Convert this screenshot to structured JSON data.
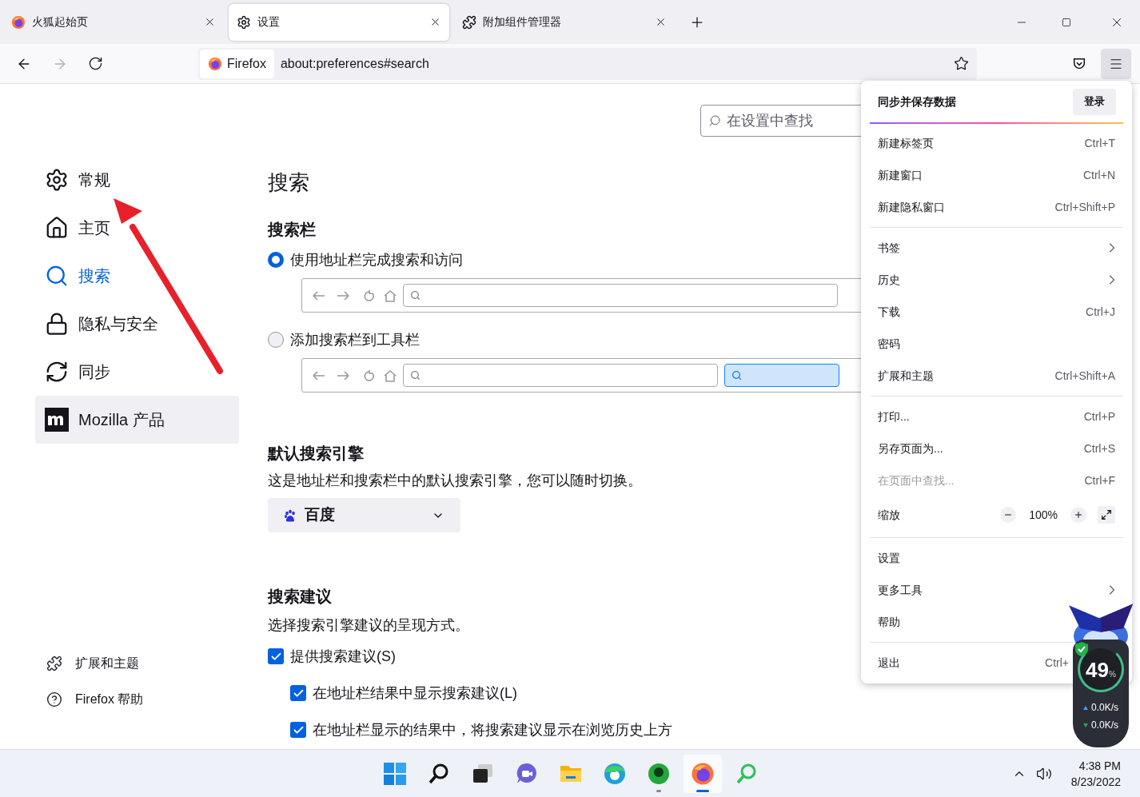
{
  "tabs": [
    {
      "label": "火狐起始页",
      "selected": false
    },
    {
      "label": "设置",
      "selected": true
    },
    {
      "label": "附加组件管理器",
      "selected": false
    }
  ],
  "address_bar": {
    "identity": "Firefox",
    "url": "about:preferences#search"
  },
  "search_field": {
    "placeholder": "在设置中查找"
  },
  "sidebar": {
    "items": [
      {
        "label": "常规",
        "selected": false,
        "hovered": false
      },
      {
        "label": "主页",
        "selected": false,
        "hovered": false
      },
      {
        "label": "搜索",
        "selected": true,
        "hovered": false
      },
      {
        "label": "隐私与安全",
        "selected": false,
        "hovered": false
      },
      {
        "label": "同步",
        "selected": false,
        "hovered": false
      },
      {
        "label": "Mozilla 产品",
        "selected": false,
        "hovered": true
      }
    ],
    "footer": [
      {
        "label": "扩展和主题"
      },
      {
        "label": "Firefox 帮助"
      }
    ]
  },
  "page_title": "搜索",
  "search_bar_section": {
    "heading": "搜索栏",
    "options": [
      {
        "label": "使用地址栏完成搜索和访问",
        "selected": true
      },
      {
        "label": "添加搜索栏到工具栏",
        "selected": false
      }
    ]
  },
  "default_engine": {
    "heading": "默认搜索引擎",
    "description": "这是地址栏和搜索栏中的默认搜索引擎，您可以随时切换。",
    "engine": "百度"
  },
  "suggestions": {
    "heading": "搜索建议",
    "description": "选择搜索引擎建议的呈现方式。",
    "options": [
      {
        "label": "提供搜索建议(S)",
        "checked": true,
        "children": [
          {
            "label": "在地址栏结果中显示搜索建议(L)",
            "checked": true
          },
          {
            "label": "在地址栏显示的结果中，将搜索建议显示在浏览历史上方",
            "checked": true
          }
        ]
      }
    ]
  },
  "menu": {
    "title": "同步并保存数据",
    "sign_in": "登录",
    "groups": [
      [
        {
          "kind": "item",
          "label": "新建标签页",
          "shortcut": "Ctrl+T",
          "disabled": false
        },
        {
          "kind": "item",
          "label": "新建窗口",
          "shortcut": "Ctrl+N",
          "disabled": false
        },
        {
          "kind": "item",
          "label": "新建隐私窗口",
          "shortcut": "Ctrl+Shift+P",
          "disabled": false
        }
      ],
      [
        {
          "kind": "submenu",
          "label": "书签",
          "disabled": false
        },
        {
          "kind": "submenu",
          "label": "历史",
          "disabled": false
        },
        {
          "kind": "item",
          "label": "下载",
          "shortcut": "Ctrl+J",
          "disabled": false
        },
        {
          "kind": "item",
          "label": "密码",
          "disabled": false
        },
        {
          "kind": "item",
          "label": "扩展和主题",
          "shortcut": "Ctrl+Shift+A",
          "disabled": false
        }
      ],
      [
        {
          "kind": "item",
          "label": "打印...",
          "shortcut": "Ctrl+P",
          "disabled": false
        },
        {
          "kind": "item",
          "label": "另存页面为...",
          "shortcut": "Ctrl+S",
          "disabled": false
        },
        {
          "kind": "item",
          "label": "在页面中查找...",
          "shortcut": "Ctrl+F",
          "disabled": true
        },
        {
          "kind": "zoom",
          "label": "缩放",
          "value": "100%",
          "disabled": false
        }
      ],
      [
        {
          "kind": "item",
          "label": "设置",
          "disabled": false
        },
        {
          "kind": "submenu",
          "label": "更多工具",
          "disabled": false
        },
        {
          "kind": "item",
          "label": "帮助",
          "disabled": false
        }
      ],
      [
        {
          "kind": "item",
          "label": "退出",
          "shortcut": "Ctrl+",
          "disabled": false
        }
      ]
    ]
  },
  "widget": {
    "percent": "49",
    "unit": "%",
    "upload": "0.0K/s",
    "download": "0.0K/s"
  },
  "taskbar": {
    "apps": [
      {
        "selected": false,
        "running": false
      },
      {
        "selected": false,
        "running": false
      },
      {
        "selected": false,
        "running": false
      },
      {
        "selected": false,
        "running": false
      },
      {
        "selected": false,
        "running": false
      },
      {
        "selected": false,
        "running": false
      },
      {
        "selected": false,
        "running": true
      },
      {
        "selected": true,
        "running": true
      },
      {
        "selected": false,
        "running": false
      }
    ],
    "time": "4:38 PM",
    "date": "8/23/2022"
  }
}
